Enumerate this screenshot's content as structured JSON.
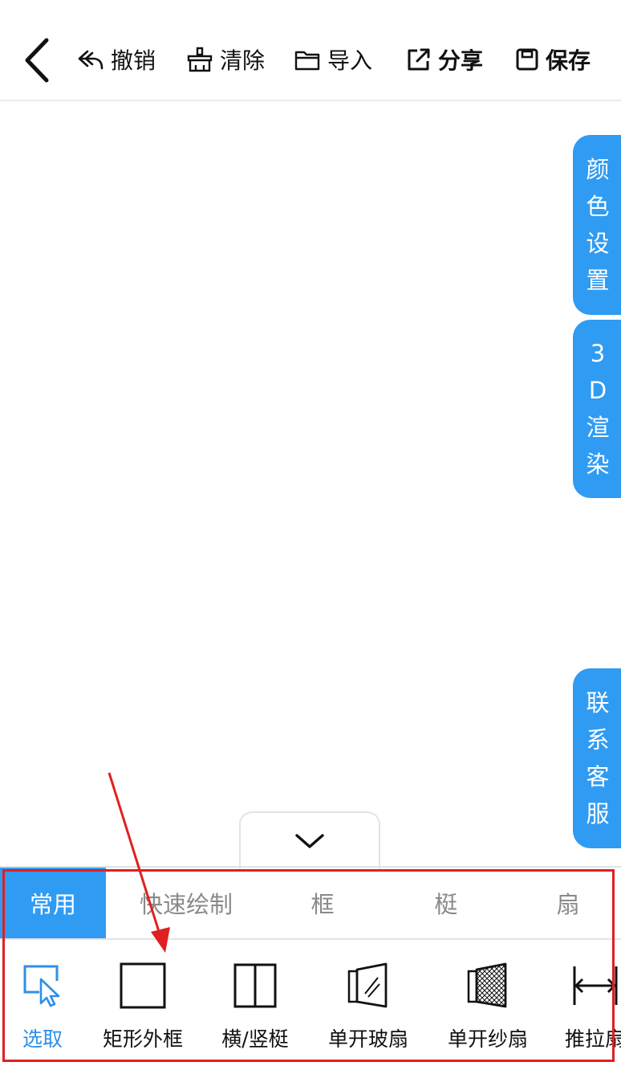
{
  "toolbar": {
    "back_icon": "chevron-left-icon",
    "undo_label": "撤销",
    "clear_label": "清除",
    "import_label": "导入",
    "share_label": "分享",
    "save_label": "保存"
  },
  "side_tabs": {
    "color": [
      "颜",
      "色",
      "设",
      "置"
    ],
    "render": [
      "3",
      "D",
      "渲",
      "染"
    ],
    "support": [
      "联",
      "系",
      "客",
      "服"
    ]
  },
  "tabs": [
    "常用",
    "快速绘制",
    "框",
    "梃",
    "扇"
  ],
  "active_tab": "常用",
  "tools": [
    "选取",
    "矩形外框",
    "横/竖梃",
    "单开玻扇",
    "单开纱扇",
    "推拉扇"
  ],
  "active_tool": "选取",
  "colors": {
    "accent": "#2f9bf3",
    "annotation": "#e02020"
  }
}
